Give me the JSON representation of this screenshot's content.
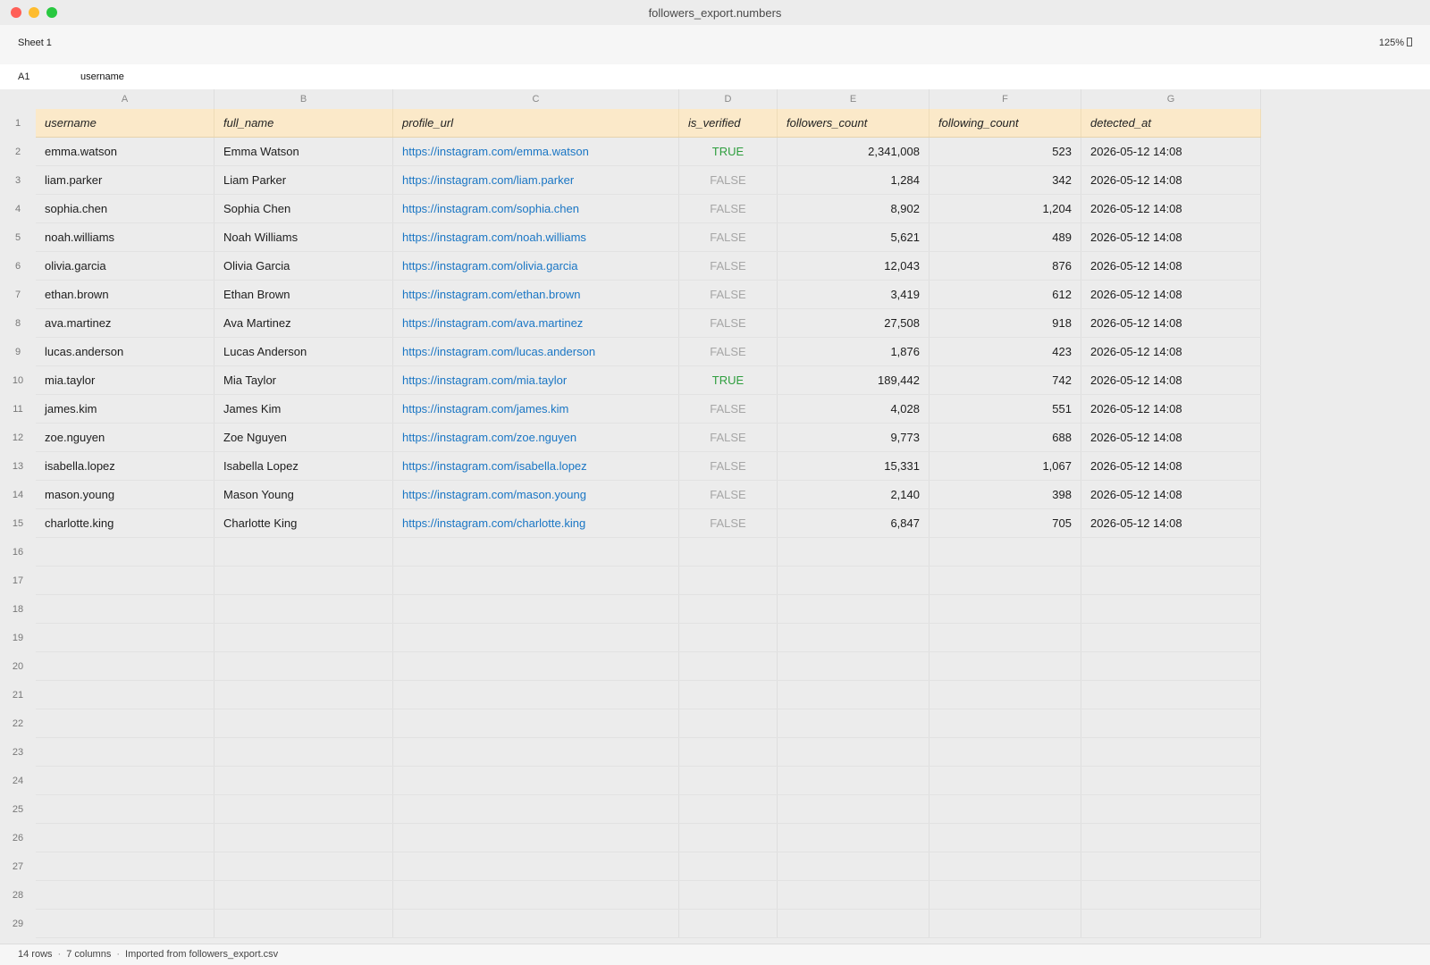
{
  "window": {
    "title": "followers_export.numbers"
  },
  "toolbar": {
    "sheet_tab": "Sheet 1",
    "zoom": "125%"
  },
  "formula_bar": {
    "cell_ref": "A1",
    "value": "username"
  },
  "columns": [
    "A",
    "B",
    "C",
    "D",
    "E",
    "F",
    "G"
  ],
  "table": {
    "headers": [
      "username",
      "full_name",
      "profile_url",
      "is_verified",
      "followers_count",
      "following_count",
      "detected_at"
    ],
    "rows": [
      [
        "emma.watson",
        "Emma Watson",
        "https://instagram.com/emma.watson",
        "TRUE",
        "2,341,008",
        "523",
        "2026-05-12 14:08"
      ],
      [
        "liam.parker",
        "Liam Parker",
        "https://instagram.com/liam.parker",
        "FALSE",
        "1,284",
        "342",
        "2026-05-12 14:08"
      ],
      [
        "sophia.chen",
        "Sophia Chen",
        "https://instagram.com/sophia.chen",
        "FALSE",
        "8,902",
        "1,204",
        "2026-05-12 14:08"
      ],
      [
        "noah.williams",
        "Noah Williams",
        "https://instagram.com/noah.williams",
        "FALSE",
        "5,621",
        "489",
        "2026-05-12 14:08"
      ],
      [
        "olivia.garcia",
        "Olivia Garcia",
        "https://instagram.com/olivia.garcia",
        "FALSE",
        "12,043",
        "876",
        "2026-05-12 14:08"
      ],
      [
        "ethan.brown",
        "Ethan Brown",
        "https://instagram.com/ethan.brown",
        "FALSE",
        "3,419",
        "612",
        "2026-05-12 14:08"
      ],
      [
        "ava.martinez",
        "Ava Martinez",
        "https://instagram.com/ava.martinez",
        "FALSE",
        "27,508",
        "918",
        "2026-05-12 14:08"
      ],
      [
        "lucas.anderson",
        "Lucas Anderson",
        "https://instagram.com/lucas.anderson",
        "FALSE",
        "1,876",
        "423",
        "2026-05-12 14:08"
      ],
      [
        "mia.taylor",
        "Mia Taylor",
        "https://instagram.com/mia.taylor",
        "TRUE",
        "189,442",
        "742",
        "2026-05-12 14:08"
      ],
      [
        "james.kim",
        "James Kim",
        "https://instagram.com/james.kim",
        "FALSE",
        "4,028",
        "551",
        "2026-05-12 14:08"
      ],
      [
        "zoe.nguyen",
        "Zoe Nguyen",
        "https://instagram.com/zoe.nguyen",
        "FALSE",
        "9,773",
        "688",
        "2026-05-12 14:08"
      ],
      [
        "isabella.lopez",
        "Isabella Lopez",
        "https://instagram.com/isabella.lopez",
        "FALSE",
        "15,331",
        "1,067",
        "2026-05-12 14:08"
      ],
      [
        "mason.young",
        "Mason Young",
        "https://instagram.com/mason.young",
        "FALSE",
        "2,140",
        "398",
        "2026-05-12 14:08"
      ],
      [
        "charlotte.king",
        "Charlotte King",
        "https://instagram.com/charlotte.king",
        "FALSE",
        "6,847",
        "705",
        "2026-05-12 14:08"
      ]
    ],
    "row_numbers": [
      "1",
      "2",
      "3",
      "4",
      "5",
      "6",
      "7",
      "8",
      "9",
      "10",
      "11",
      "12",
      "13",
      "14",
      "15",
      "16",
      "17",
      "18",
      "19",
      "20",
      "21",
      "22",
      "23",
      "24",
      "25",
      "26",
      "27",
      "28",
      "29"
    ]
  },
  "status": {
    "rows": "14 rows",
    "cols": "7 columns",
    "source": "Imported from followers_export.csv"
  },
  "colors": {
    "header_fill": "#fbe9c9",
    "link": "#1a76c4",
    "true": "#2e9e3e",
    "false": "#a6a6a6"
  }
}
